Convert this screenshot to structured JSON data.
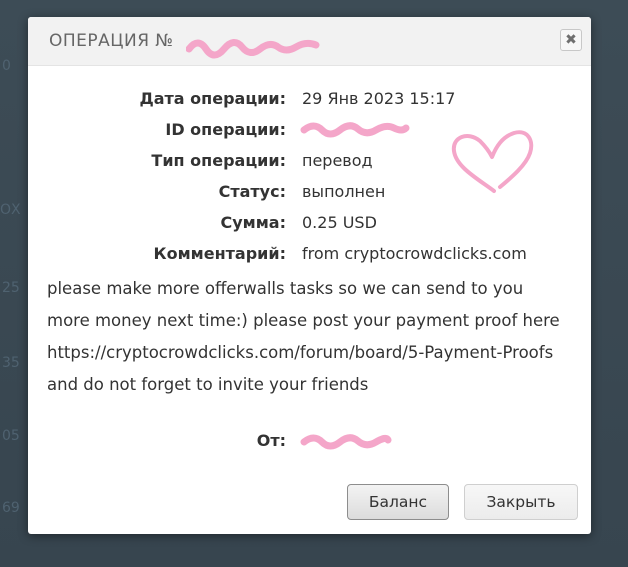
{
  "dialog": {
    "title": "ОПЕРАЦИЯ №",
    "close_glyph": "✖",
    "fields": [
      {
        "label": "Дата операции:",
        "value": "29 Янв 2023 15:17"
      },
      {
        "label": "ID операции:",
        "value": ""
      },
      {
        "label": "Тип операции:",
        "value": "перевод"
      },
      {
        "label": "Статус:",
        "value": "выполнен"
      },
      {
        "label": "Сумма:",
        "value": "0.25 USD"
      },
      {
        "label": "Комментарий:",
        "value": "from cryptocrowdclicks.com"
      }
    ],
    "comment_continuation": "please make more offerwalls tasks so we can send to you more money next time:) please post your payment proof here https://cryptocrowdclicks.com/forum/board/5-Payment-Proofs and do not forget to invite your friends",
    "from_label": "От:",
    "buttons": {
      "balance": "Баланс",
      "close": "Закрыть"
    }
  },
  "background": {
    "fragments": [
      "0",
      "ОХ",
      "25",
      "35",
      "05",
      "69"
    ]
  },
  "colors": {
    "backdrop": "#3b4a54",
    "header_bg": "#f2f2f2",
    "redaction_marker": "#f4a6c9"
  }
}
